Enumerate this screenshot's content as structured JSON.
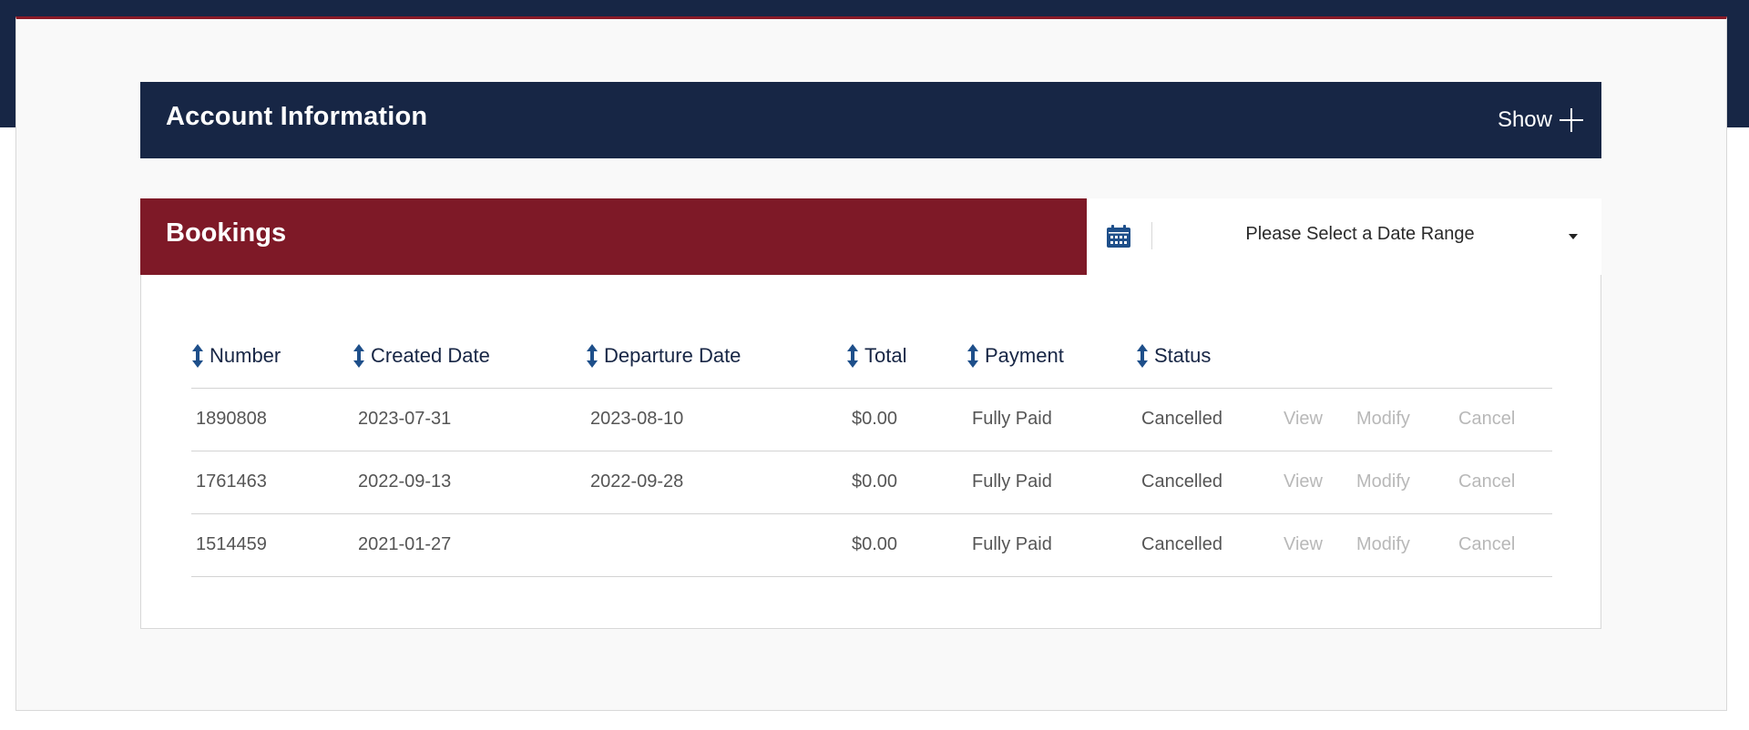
{
  "account": {
    "title": "Account Information",
    "toggle_label": "Show",
    "toggle_icon": "plus-icon"
  },
  "bookings": {
    "title": "Bookings",
    "date_filter": {
      "placeholder": "Please Select a Date Range",
      "icon": "calendar-icon"
    },
    "columns": [
      "Number",
      "Created Date",
      "Departure Date",
      "Total",
      "Payment",
      "Status"
    ],
    "rows": [
      {
        "number": "1890808",
        "created": "2023-07-31",
        "departure": "2023-08-10",
        "total": "$0.00",
        "payment": "Fully Paid",
        "status": "Cancelled"
      },
      {
        "number": "1761463",
        "created": "2022-09-13",
        "departure": "2022-09-28",
        "total": "$0.00",
        "payment": "Fully Paid",
        "status": "Cancelled"
      },
      {
        "number": "1514459",
        "created": "2021-01-27",
        "departure": "",
        "total": "$0.00",
        "payment": "Fully Paid",
        "status": "Cancelled"
      }
    ],
    "actions": {
      "view": "View",
      "modify": "Modify",
      "cancel": "Cancel"
    }
  },
  "colors": {
    "navy": "#172645",
    "crimson": "#7e1927",
    "sort_icon": "#1e4f8a"
  }
}
